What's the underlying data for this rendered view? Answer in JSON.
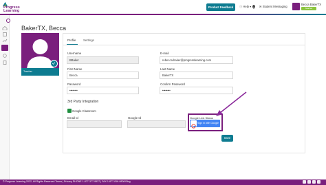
{
  "header": {
    "logo_line1": "Progress",
    "logo_line2": "Learning",
    "feedback_label": "Product Feedback",
    "help_label": "Help",
    "messaging_label": "Student Messaging",
    "user_name": "Becca BakerTX",
    "user_role": "Teacher"
  },
  "page": {
    "title": "BakerTX, Becca",
    "role_badge": "Teacher"
  },
  "tabs": [
    {
      "label": "Profile",
      "active": true
    },
    {
      "label": "Settings",
      "active": false
    }
  ],
  "form": {
    "username_label": "Username",
    "username_value": "BBaker",
    "email_label": "E-mail",
    "email_value": "rebecca.baker@progresslearning.com",
    "firstname_label": "First Name",
    "firstname_value": "Becca",
    "lastname_label": "Last Name",
    "lastname_value": "BakerTX",
    "password_label": "Password",
    "password_value": "••••••••",
    "confirm_label": "Confirm Password",
    "confirm_value": "••••••••"
  },
  "integration": {
    "section_title": "3rd Party Integration",
    "classroom_label": "Google Classroom",
    "email_id_label": "Email Id",
    "google_id_label": "Google Id",
    "link_status_label": "Google Link Status",
    "google_button_label": "Sign in with Google",
    "save_label": "Save"
  },
  "footer": {
    "text": "© Progress Learning 2022, All Rights Reserved    Terms    |    Privacy    PHONE 1-877-377-9537  |  FAX 1-877-816-0808    Blog"
  },
  "colors": {
    "brand_purple": "#7a1f7d",
    "brand_teal": "#0e7c91",
    "google_blue": "#4285f4"
  }
}
